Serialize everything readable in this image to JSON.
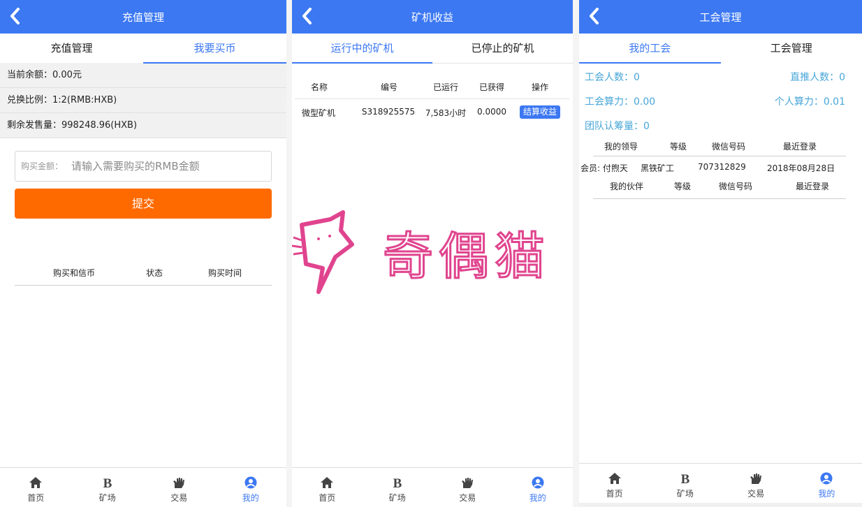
{
  "panels": [
    {
      "title": "充值管理",
      "tabs": [
        "充值管理",
        "我要买币"
      ],
      "info": [
        "当前余额：0.00元",
        "兑换比例：1:2(RMB:HXB)",
        "剩余发售量：998248.96(HXB)"
      ],
      "amount_label": "购买金额：",
      "amount_placeholder": "请输入需要购买的RMB金额",
      "submit_label": "提交",
      "columns": [
        "购买和信币",
        "状态",
        "购买时间"
      ]
    },
    {
      "title": "矿机收益",
      "tabs": [
        "运行中的矿机",
        "已停止的矿机"
      ],
      "columns": [
        "名称",
        "编号",
        "已运行",
        "已获得",
        "操作"
      ],
      "rows": [
        {
          "name": "微型矿机",
          "id": "S318925575",
          "runtime": "7,583小时",
          "earned": "0.0000",
          "action": "结算收益"
        }
      ],
      "watermark": "奇偶猫"
    },
    {
      "title": "工会管理",
      "tabs": [
        "我的工会",
        "工会管理"
      ],
      "stats": {
        "members": "工会人数：0",
        "direct": "直推人数：0",
        "guild_power": "工会算力：0.00",
        "personal_power": "个人算力：0.01",
        "team_amount": "团队认筹量：0"
      },
      "leader_columns": [
        "我的领导",
        "等级",
        "微信号码",
        "最近登录"
      ],
      "leader_row": [
        "会员: 付煦天",
        "黑铁矿工",
        "707312829",
        "2018年08月28日"
      ],
      "partner_columns": [
        "我的伙伴",
        "等级",
        "微信号码",
        "最近登录"
      ]
    }
  ],
  "nav": {
    "items": [
      {
        "label": "首页",
        "icon": "home-icon"
      },
      {
        "label": "矿场",
        "icon": "bold-b-icon"
      },
      {
        "label": "交易",
        "icon": "hand-icon"
      },
      {
        "label": "我的",
        "icon": "user-circle-icon"
      }
    ],
    "active_index": 3
  },
  "colors": {
    "primary": "#3c78f2",
    "accent": "#ff6a00",
    "stat_text": "#47a6d8",
    "watermark": "#e0448e"
  }
}
